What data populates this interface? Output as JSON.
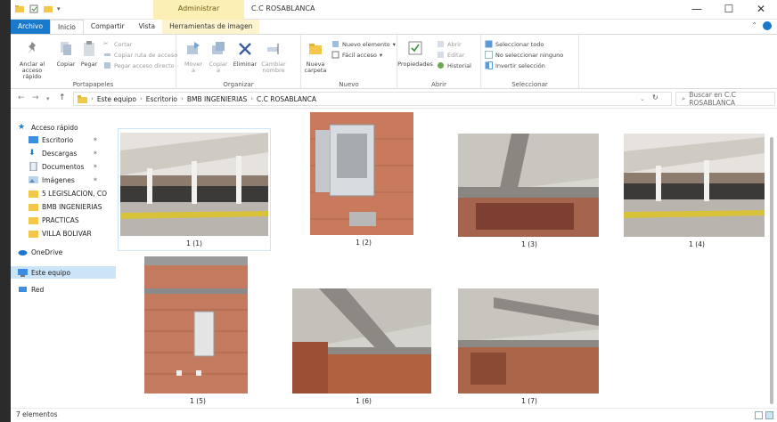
{
  "window": {
    "title": "C.C ROSABLANCA",
    "context_tab_group": "Administrar",
    "controls": {
      "minimize": "—",
      "maximize": "☐",
      "close": "✕"
    }
  },
  "tabs": [
    {
      "label": "Archivo"
    },
    {
      "label": "Inicio"
    },
    {
      "label": "Compartir"
    },
    {
      "label": "Vista"
    },
    {
      "label": "Herramientas de imagen"
    }
  ],
  "ribbon": {
    "portapapeles": {
      "label": "Portapapeles",
      "pin": "Anclar al acceso rápido",
      "copy": "Copiar",
      "paste": "Pegar",
      "cut": "Cortar",
      "copy_path": "Copiar ruta de acceso",
      "paste_shortcut": "Pegar acceso directo"
    },
    "organizar": {
      "label": "Organizar",
      "move": "Mover a",
      "copy_to": "Copiar a",
      "delete": "Eliminar",
      "rename": "Cambiar nombre"
    },
    "nuevo": {
      "label": "Nuevo",
      "new_folder": "Nueva carpeta",
      "new_item": "Nuevo elemento",
      "easy_access": "Fácil acceso"
    },
    "abrir": {
      "label": "Abrir",
      "properties": "Propiedades",
      "open": "Abrir",
      "edit": "Editar",
      "history": "Historial"
    },
    "seleccionar": {
      "label": "Seleccionar",
      "select_all": "Seleccionar todo",
      "select_none": "No seleccionar ninguno",
      "invert": "Invertir selección"
    }
  },
  "address": {
    "crumbs": [
      "Este equipo",
      "Escritorio",
      "BMB INGENIERIAS",
      "C.C ROSABLANCA"
    ],
    "search_placeholder": "Buscar en C.C ROSABLANCA"
  },
  "nav": {
    "quick_access": "Acceso rápido",
    "items": [
      {
        "label": "Escritorio",
        "pinned": true
      },
      {
        "label": "Descargas",
        "pinned": true
      },
      {
        "label": "Documentos",
        "pinned": true
      },
      {
        "label": "Imágenes",
        "pinned": true
      },
      {
        "label": "5 LEGISLACION, CO",
        "pinned": false
      },
      {
        "label": "BMB INGENIERIAS",
        "pinned": false
      },
      {
        "label": "PRACTICAS",
        "pinned": false
      },
      {
        "label": "VILLA BOLIVAR",
        "pinned": false
      }
    ],
    "onedrive": "OneDrive",
    "this_pc": "Este equipo",
    "network": "Red"
  },
  "files": [
    {
      "name": "1 (1)"
    },
    {
      "name": "1 (2)"
    },
    {
      "name": "1 (3)"
    },
    {
      "name": "1 (4)"
    },
    {
      "name": "1 (5)"
    },
    {
      "name": "1 (6)"
    },
    {
      "name": "1 (7)"
    }
  ],
  "status": {
    "count": "7 elementos"
  },
  "colors": {
    "accent": "#1979ca",
    "context_tab": "#fcefb4",
    "selection": "#cce4f7",
    "folder": "#f3c84a"
  }
}
